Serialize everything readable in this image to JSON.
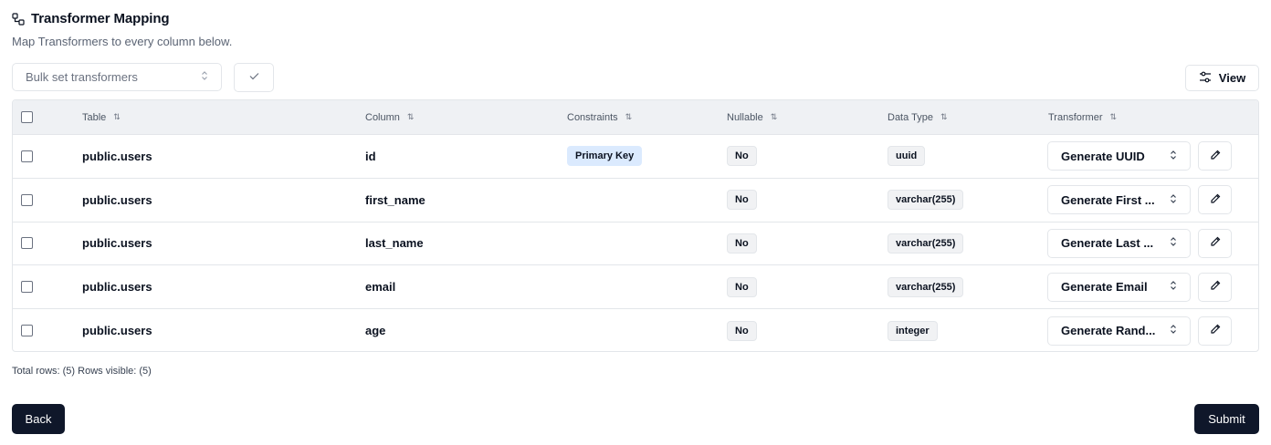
{
  "header": {
    "icon": "mapping-icon",
    "title": "Transformer Mapping",
    "subtitle": "Map Transformers to every column below."
  },
  "toolbar": {
    "bulk_placeholder": "Bulk set transformers",
    "apply_icon": "check-icon",
    "view_label": "View",
    "view_icon": "sliders-icon"
  },
  "table": {
    "headers": {
      "table": "Table",
      "column": "Column",
      "constraints": "Constraints",
      "nullable": "Nullable",
      "data_type": "Data Type",
      "transformer": "Transformer"
    },
    "rows": [
      {
        "table": "public.users",
        "column": "id",
        "constraint": "Primary Key",
        "nullable": "No",
        "data_type": "uuid",
        "transformer": "Generate UUID"
      },
      {
        "table": "public.users",
        "column": "first_name",
        "constraint": "",
        "nullable": "No",
        "data_type": "varchar(255)",
        "transformer": "Generate First ..."
      },
      {
        "table": "public.users",
        "column": "last_name",
        "constraint": "",
        "nullable": "No",
        "data_type": "varchar(255)",
        "transformer": "Generate Last ..."
      },
      {
        "table": "public.users",
        "column": "email",
        "constraint": "",
        "nullable": "No",
        "data_type": "varchar(255)",
        "transformer": "Generate Email"
      },
      {
        "table": "public.users",
        "column": "age",
        "constraint": "",
        "nullable": "No",
        "data_type": "integer",
        "transformer": "Generate Rand..."
      }
    ]
  },
  "footer": {
    "row_info": "Total rows: (5) Rows visible: (5)",
    "back_label": "Back",
    "submit_label": "Submit"
  },
  "colors": {
    "primary_button": "#0f172a",
    "pk_badge": "#dbeafe",
    "header_bg": "#eff1f4",
    "border": "#e3e6ea"
  }
}
